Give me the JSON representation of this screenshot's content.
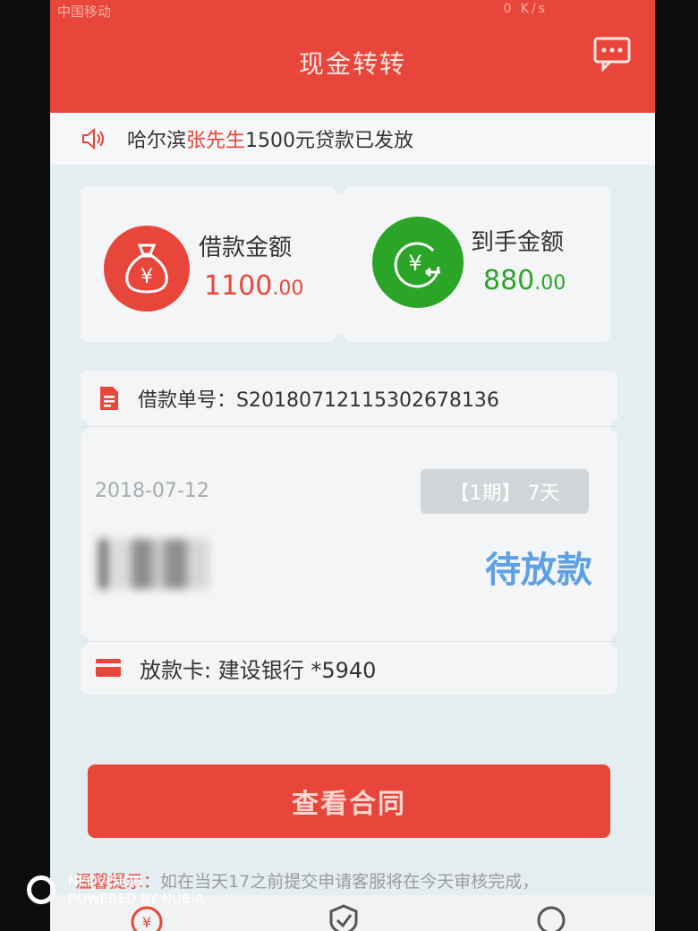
{
  "status_bar": {
    "carrier": "中国移动",
    "right": "0 K/s"
  },
  "header": {
    "title": "现金转转",
    "message_icon": "chat-bubble-icon"
  },
  "notice": {
    "prefix": "哈尔滨",
    "highlight": "张先生",
    "suffix": "1500元贷款已发放",
    "icon": "speaker-icon"
  },
  "amounts": {
    "loan": {
      "label": "借款金额",
      "integer": "1100",
      "decimal": ".00",
      "color": "#e8463a",
      "icon": "money-bag-icon"
    },
    "received": {
      "label": "到手金额",
      "integer": "880",
      "decimal": ".00",
      "color": "#2aa527",
      "icon": "yuan-return-icon"
    }
  },
  "order": {
    "number_label": "借款单号：",
    "number": "S20180712115302678136",
    "date": "2018-07-12",
    "period": "【1期】 7天",
    "status": "待放款",
    "status_color": "#5ea0e6",
    "card_label": "放款卡: ",
    "card": "建设银行 *5940"
  },
  "contract_button": "查看合同",
  "tip": {
    "label": "温馨提示：",
    "text": "如在当天17之前提交申请客服将在今天审核完成，"
  },
  "watermark": {
    "line1": "NEOVISION",
    "line2": "POWERED BY NUBIA"
  },
  "colors": {
    "brand_red": "#e8463a",
    "green": "#2aa527",
    "blue": "#5ea0e6"
  }
}
